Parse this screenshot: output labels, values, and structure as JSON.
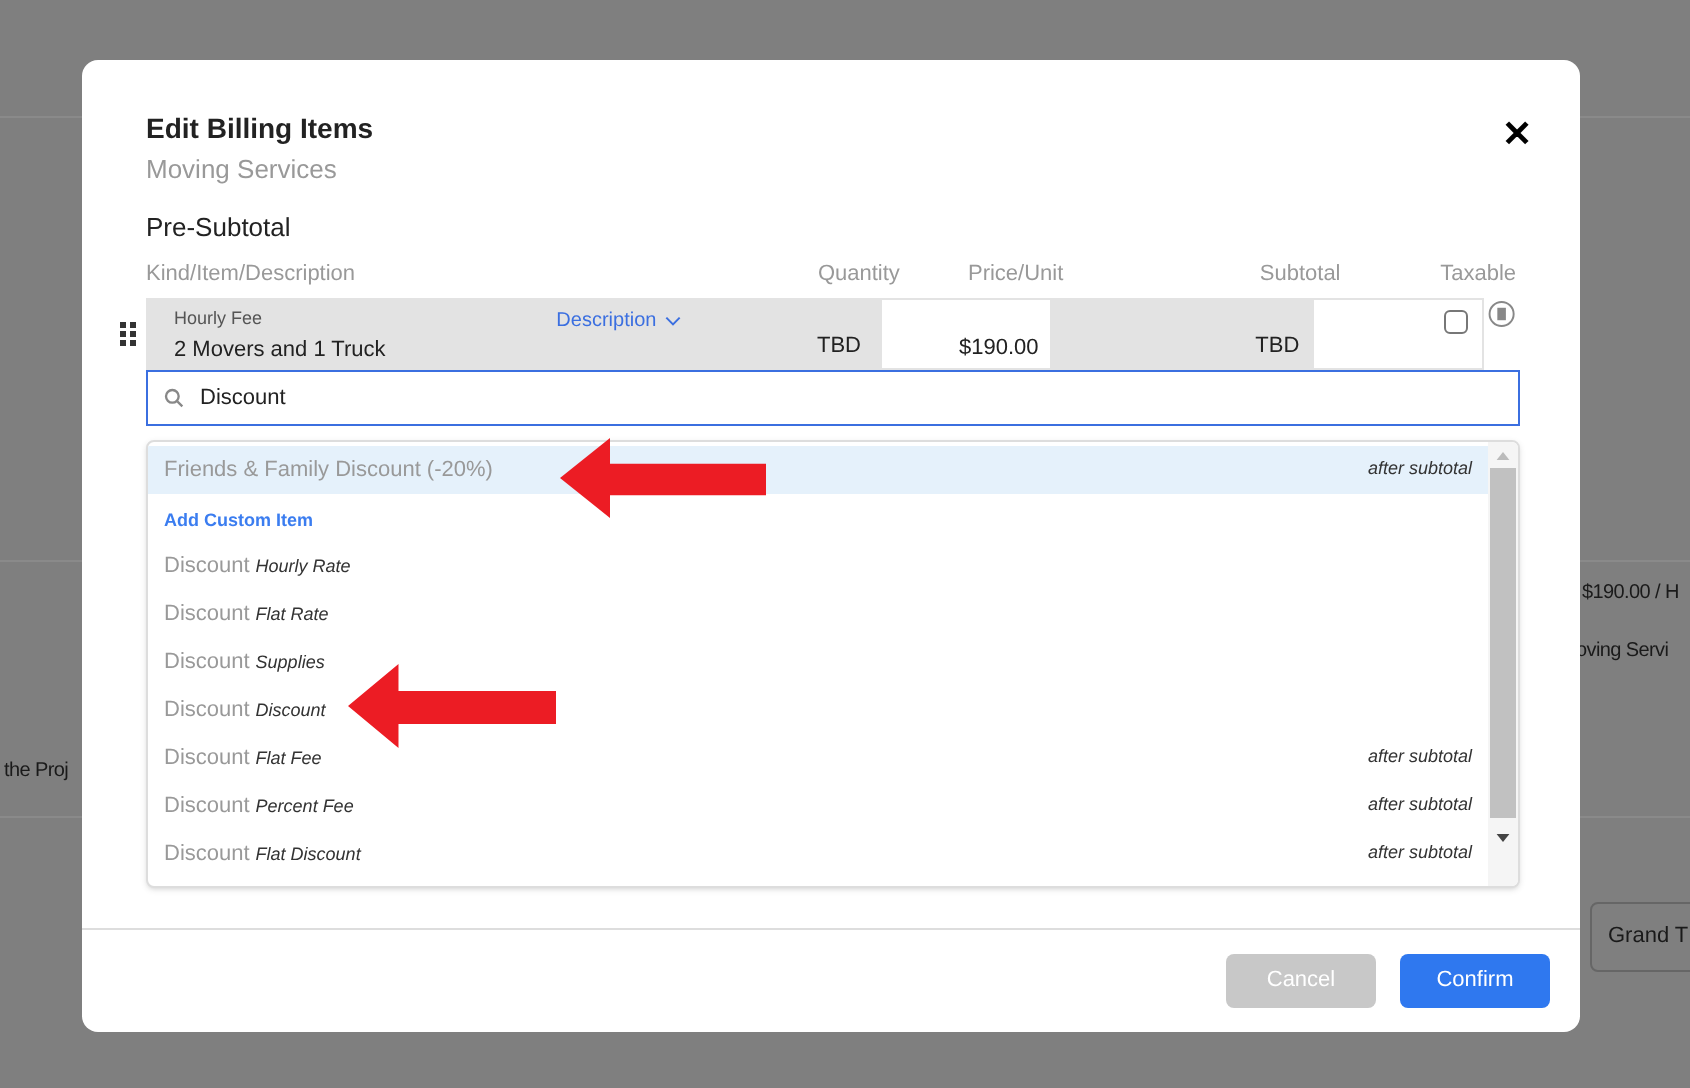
{
  "background": {
    "fragments": [
      {
        "text": "$190.00 / H",
        "kind": "plain"
      },
      {
        "text": "oving Servi",
        "kind": "plain"
      },
      {
        "text": "the Proj",
        "kind": "plain"
      },
      {
        "text": "Grand T",
        "kind": "boxed"
      }
    ]
  },
  "modal": {
    "title": "Edit Billing Items",
    "subtitle": "Moving Services",
    "close": "✕"
  },
  "section": "Pre-Subtotal",
  "columns": [
    "Kind/Item/Description",
    "Quantity",
    "Price/Unit",
    "Subtotal",
    "Taxable"
  ],
  "item": {
    "kind_label": "Hourly Fee",
    "name": "2 Movers and 1 Truck",
    "description_link": "Description",
    "quantity": "TBD",
    "price": "$190.00",
    "subtotal": "TBD",
    "taxable": false
  },
  "search": {
    "value": "Discount"
  },
  "dropdown": [
    {
      "kind": "preset",
      "label": "Friends & Family Discount (-20%)",
      "note": "after subtotal",
      "highlighted": true
    },
    {
      "kind": "custom_header",
      "label": "Add Custom Item"
    },
    {
      "kind": "option",
      "prefix": "Discount",
      "name": "Hourly Rate",
      "highlighted": false
    },
    {
      "kind": "option",
      "prefix": "Discount",
      "name": "Flat Rate",
      "highlighted": false
    },
    {
      "kind": "option",
      "prefix": "Discount",
      "name": "Supplies",
      "highlighted": false
    },
    {
      "kind": "option",
      "prefix": "Discount",
      "name": "Discount",
      "highlighted": false
    },
    {
      "kind": "option",
      "prefix": "Discount",
      "name": "Flat Fee",
      "note": "after subtotal",
      "highlighted": false
    },
    {
      "kind": "option",
      "prefix": "Discount",
      "name": "Percent Fee",
      "note": "after subtotal",
      "highlighted": false
    },
    {
      "kind": "option",
      "prefix": "Discount",
      "name": "Flat Discount",
      "note": "after subtotal",
      "highlighted": false
    }
  ],
  "buttons": [
    {
      "label": "Cancel",
      "disabled": true
    },
    {
      "label": "Confirm",
      "disabled": false
    }
  ]
}
